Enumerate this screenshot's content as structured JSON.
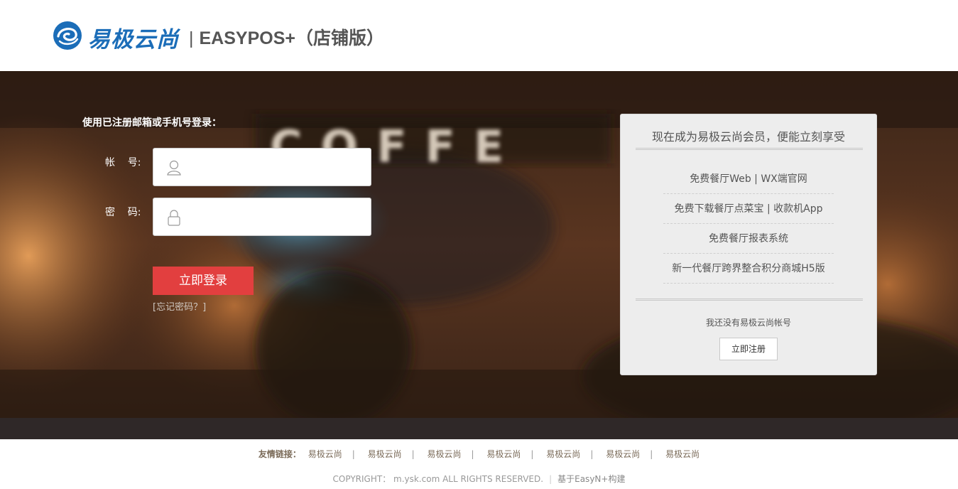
{
  "header": {
    "logo_text": "易极云尚",
    "separator": "|",
    "product_title": "EASYPOS+（店铺版）"
  },
  "banner": {
    "sign_text": "COFFE"
  },
  "login": {
    "title": "使用已注册邮箱或手机号登录：",
    "account_label": "帐    号:",
    "password_label": "密    码:",
    "account_value": "",
    "password_value": "",
    "submit_label": "立即登录",
    "forgot_label": "[忘记密码？]"
  },
  "panel": {
    "title": "现在成为易极云尚会员，便能立刻享受",
    "benefits": [
      "免费餐厅Web | WX端官网",
      "免费下载餐厅点菜宝 | 收款机App",
      "免费餐厅报表系统",
      "新一代餐厅跨界整合积分商城H5版"
    ],
    "no_account_text": "我还没有易极云尚帐号",
    "register_label": "立即注册"
  },
  "footer": {
    "links_label": "友情链接：",
    "links": [
      "易极云尚",
      "易极云尚",
      "易极云尚",
      "易极云尚",
      "易极云尚",
      "易极云尚",
      "易极云尚"
    ],
    "copyright": "COPYRIGHT：  m.ysk.com ALL RIGHTS RESERVED.",
    "built_with": "基于EasyN+构建"
  },
  "colors": {
    "brand_blue": "#1b6db8",
    "login_button": "#e23f3f",
    "panel_bg": "#ededed"
  }
}
